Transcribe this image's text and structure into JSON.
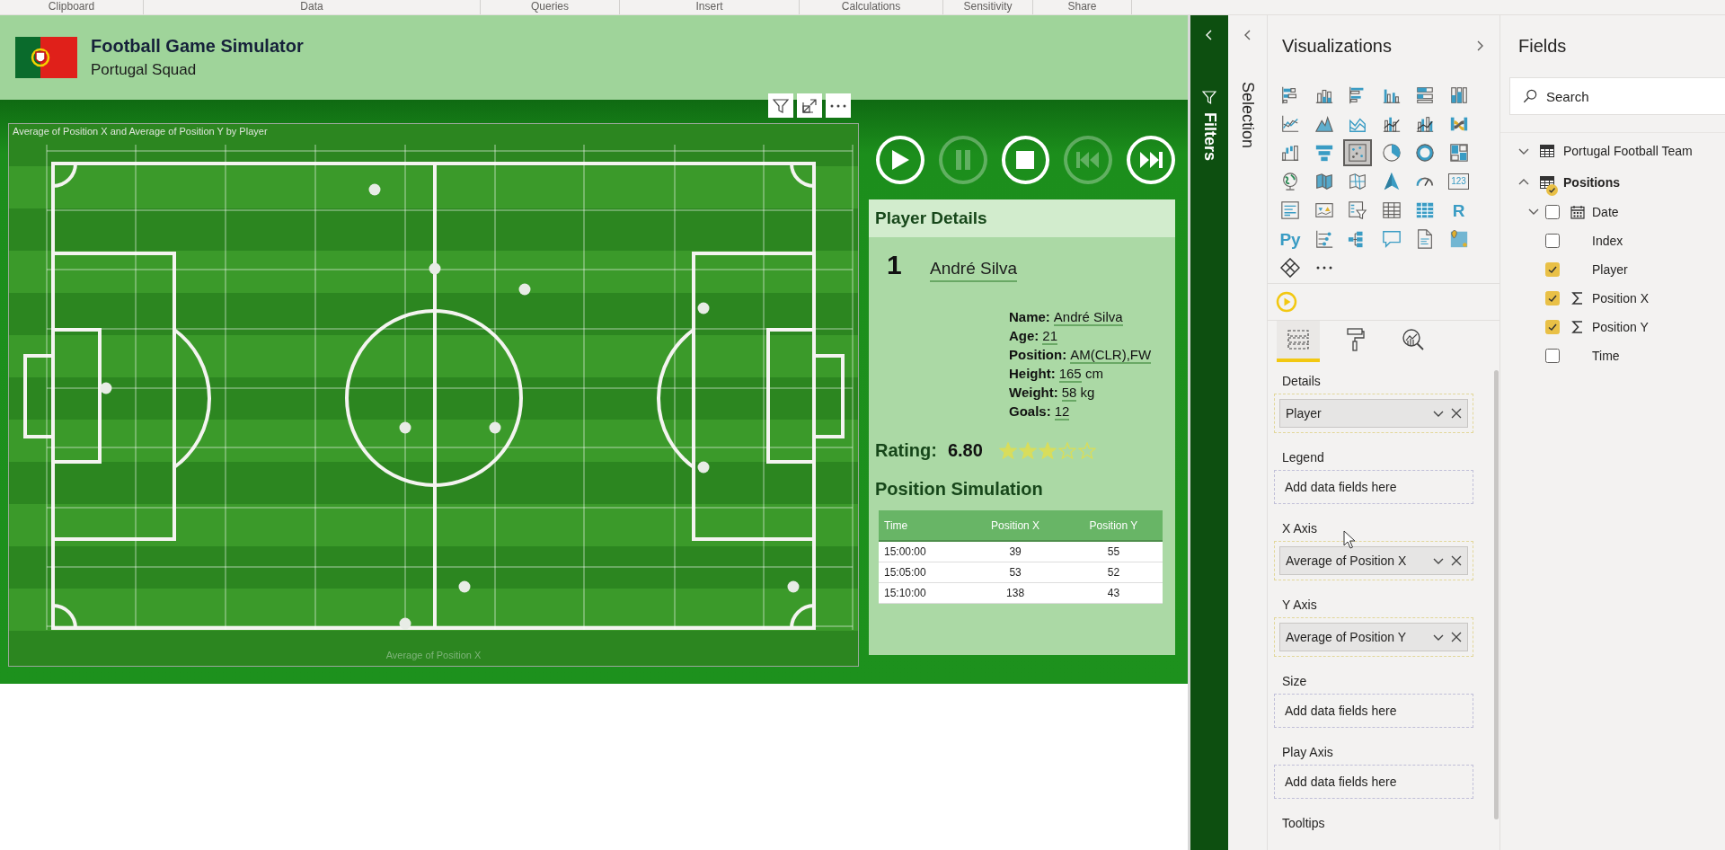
{
  "ribbon": {
    "groups": [
      "Clipboard",
      "Data",
      "Queries",
      "Insert",
      "Calculations",
      "Sensitivity",
      "Share"
    ]
  },
  "report": {
    "title": "Football Game Simulator",
    "subtitle": "Portugal Squad",
    "chart": {
      "title": "Average of Position X and Average of Position Y by Player",
      "x_axis_title": "Average of Position X"
    },
    "controls": [
      {
        "kind": "play",
        "disabled": false
      },
      {
        "kind": "pause",
        "disabled": true
      },
      {
        "kind": "stop",
        "disabled": false
      },
      {
        "kind": "previous",
        "disabled": true
      },
      {
        "kind": "next",
        "disabled": false
      }
    ],
    "player": {
      "header": "Player Details",
      "number": "1",
      "name": "André Silva",
      "details": [
        {
          "label": "Name:",
          "value": "André Silva"
        },
        {
          "label": "Age:",
          "value": "21"
        },
        {
          "label": "Position:",
          "value": "AM(CLR),FW"
        },
        {
          "label": "Height:",
          "value": "165",
          "unit": "cm"
        },
        {
          "label": "Weight:",
          "value": "58",
          "unit": "kg"
        },
        {
          "label": "Goals:",
          "value": "12"
        }
      ],
      "rating_label": "Rating:",
      "rating": "6.80",
      "stars": 3,
      "simulation": {
        "title": "Position Simulation",
        "columns": [
          "Time",
          "Position X",
          "Position Y"
        ],
        "rows": [
          [
            "15:00:00",
            "39",
            "55"
          ],
          [
            "15:05:00",
            "53",
            "52"
          ],
          [
            "15:10:00",
            "138",
            "43"
          ]
        ]
      }
    }
  },
  "filters_pane": {
    "title": "Filters"
  },
  "selection_pane": {
    "title": "Selection"
  },
  "visualizations": {
    "title": "Visualizations",
    "gallery": [
      {
        "kind": "stacked-bar-chart",
        "selected": false
      },
      {
        "kind": "stacked-column-chart",
        "selected": false
      },
      {
        "kind": "clustered-bar-chart",
        "selected": false
      },
      {
        "kind": "clustered-column-chart",
        "selected": false
      },
      {
        "kind": "full-stacked-bar-chart",
        "selected": false
      },
      {
        "kind": "full-stacked-column-chart",
        "selected": false
      },
      {
        "kind": "line-chart",
        "selected": false
      },
      {
        "kind": "area-chart",
        "selected": false
      },
      {
        "kind": "stacked-area-chart",
        "selected": false
      },
      {
        "kind": "line-column-chart",
        "selected": false
      },
      {
        "kind": "line-clustered-column-chart",
        "selected": false
      },
      {
        "kind": "ribbon-chart",
        "selected": false
      },
      {
        "kind": "waterfall-chart",
        "selected": false
      },
      {
        "kind": "funnel-chart",
        "selected": false
      },
      {
        "kind": "scatter-chart",
        "selected": true
      },
      {
        "kind": "pie-chart",
        "selected": false
      },
      {
        "kind": "donut-chart",
        "selected": false
      },
      {
        "kind": "treemap",
        "selected": false
      },
      {
        "kind": "globe",
        "selected": false
      },
      {
        "kind": "filled-map",
        "selected": false
      },
      {
        "kind": "shape-map",
        "selected": false
      },
      {
        "kind": "navigation-arrow",
        "selected": false
      },
      {
        "kind": "gauge",
        "selected": false
      },
      {
        "kind": "card",
        "label": "123",
        "selected": false
      },
      {
        "kind": "multi-row-card",
        "selected": false
      },
      {
        "kind": "kpi",
        "selected": false
      },
      {
        "kind": "slicer",
        "selected": false
      },
      {
        "kind": "table",
        "selected": false
      },
      {
        "kind": "matrix",
        "selected": false
      },
      {
        "kind": "r-script",
        "label": "R",
        "selected": false
      },
      {
        "kind": "python-script",
        "label": "Py",
        "selected": false
      },
      {
        "kind": "key-influencers",
        "selected": false
      },
      {
        "kind": "decomposition-tree",
        "selected": false
      },
      {
        "kind": "speech-bubble",
        "selected": false
      },
      {
        "kind": "document",
        "selected": false
      },
      {
        "kind": "map-pin",
        "selected": false
      },
      {
        "kind": "diamond",
        "selected": false
      },
      {
        "kind": "more",
        "selected": false
      }
    ],
    "build_tabs": [
      {
        "kind": "fields",
        "selected": true
      },
      {
        "kind": "format",
        "selected": false
      },
      {
        "kind": "analytics",
        "selected": false
      }
    ],
    "wells": [
      {
        "label": "Details",
        "field": "Player"
      },
      {
        "label": "Legend",
        "placeholder": "Add data fields here"
      },
      {
        "label": "X Axis",
        "field": "Average of Position X"
      },
      {
        "label": "Y Axis",
        "field": "Average of Position Y"
      },
      {
        "label": "Size",
        "placeholder": "Add data fields here"
      },
      {
        "label": "Play Axis",
        "placeholder": "Add data fields here"
      },
      {
        "label": "Tooltips"
      }
    ]
  },
  "fields": {
    "title": "Fields",
    "search": {
      "placeholder": "Search"
    },
    "tables": [
      {
        "name": "Portugal Football Team",
        "expanded": false,
        "in_use": false
      },
      {
        "name": "Positions",
        "expanded": true,
        "in_use": true,
        "children": [
          {
            "name": "Date",
            "kind": "date",
            "checked": false,
            "expanded": false
          },
          {
            "name": "Index",
            "kind": "plain",
            "checked": false
          },
          {
            "name": "Player",
            "kind": "plain",
            "checked": true
          },
          {
            "name": "Position X",
            "kind": "sum",
            "checked": true
          },
          {
            "name": "Position Y",
            "kind": "sum",
            "checked": true
          },
          {
            "name": "Time",
            "kind": "plain",
            "checked": false
          }
        ]
      }
    ]
  }
}
